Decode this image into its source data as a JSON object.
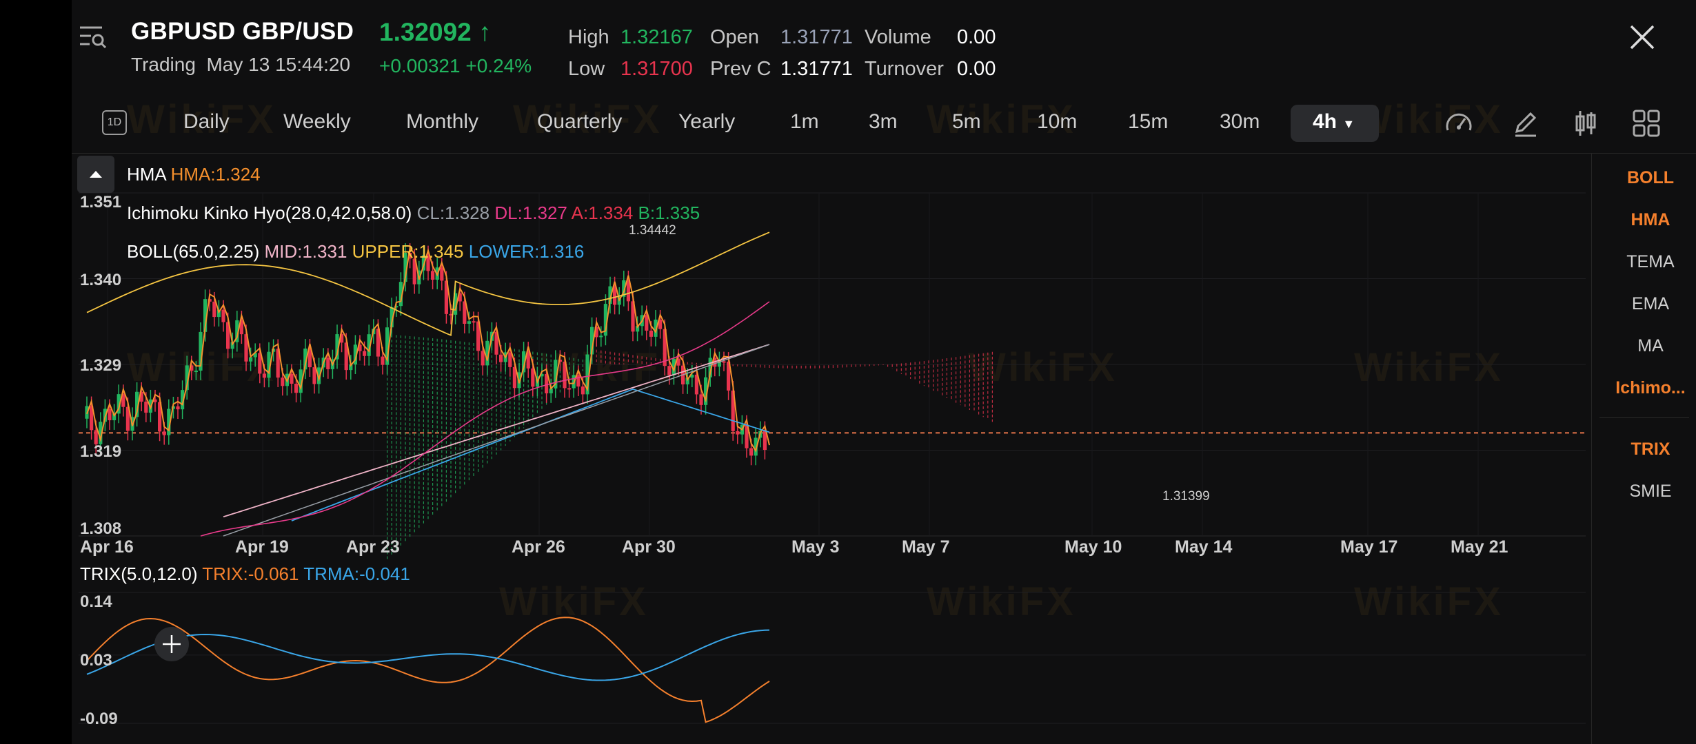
{
  "header": {
    "symbol": "GBPUSD",
    "pair": "GBP/USD",
    "price": "1.32092",
    "price_arrow": "↑",
    "status": "Trading",
    "datetime": "May 13 15:44:20",
    "change": "+0.00321",
    "change_pct": "+0.24%"
  },
  "stats": {
    "high_label": "High",
    "high": "1.32167",
    "low_label": "Low",
    "low": "1.31700",
    "open_label": "Open",
    "open": "1.31771",
    "prevc_label": "Prev C",
    "prevc": "1.31771",
    "volume_label": "Volume",
    "volume": "0.00",
    "turnover_label": "Turnover",
    "turnover": "0.00"
  },
  "timeframes": [
    "Daily",
    "Weekly",
    "Monthly",
    "Quarterly",
    "Yearly",
    "1m",
    "3m",
    "5m",
    "10m",
    "15m",
    "30m"
  ],
  "timeframe_icon_label": "1D",
  "active_timeframe": "4h",
  "toolbar": {
    "icons": [
      "speedometer-icon",
      "pen-icon",
      "candlestick-icon",
      "grid-icon"
    ]
  },
  "legend": {
    "hma": {
      "name": "HMA",
      "value": "HMA:1.324"
    },
    "ichimoku": {
      "name": "Ichimoku Kinko Hyo(28.0,42.0,58.0)",
      "cl": "CL:1.328",
      "dl": "DL:1.327",
      "a": "A:1.334",
      "b": "B:1.335"
    },
    "boll": {
      "name": "BOLL(65.0,2.25)",
      "mid": "MID:1.331",
      "upper": "UPPER:1.345",
      "lower": "LOWER:1.316"
    },
    "trix": {
      "name": "TRIX(5.0,12.0)",
      "trix": "TRIX:-0.061",
      "trma": "TRMA:-0.041"
    }
  },
  "side_indicators": [
    {
      "label": "BOLL",
      "active": true
    },
    {
      "label": "HMA",
      "active": true
    },
    {
      "label": "TEMA",
      "active": false
    },
    {
      "label": "EMA",
      "active": false
    },
    {
      "label": "MA",
      "active": false
    },
    {
      "label": "Ichimo...",
      "active": true
    },
    {
      "label": "TRIX",
      "active": true
    },
    {
      "label": "SMIE",
      "active": false
    }
  ],
  "price_axis": [
    "1.351",
    "1.340",
    "1.329",
    "1.319",
    "1.308"
  ],
  "trix_axis": [
    "0.14",
    "0.03",
    "-0.09"
  ],
  "date_axis": [
    "Apr 16",
    "Apr 19",
    "Apr 23",
    "Apr 26",
    "Apr 30",
    "May 3",
    "May 7",
    "May 10",
    "May 14",
    "May 17",
    "May 21"
  ],
  "annotations": {
    "max": "1.34442",
    "min": "1.31399"
  },
  "watermark": "WikiFX",
  "colors": {
    "up": "#22b55f",
    "down": "#e8344e",
    "accent": "#f5802d",
    "hma": "#f5902d",
    "boll_upper": "#f5c542",
    "boll_mid": "#f0b4c8",
    "boll_lower": "#3aa6e8",
    "ichimoku_cl": "#9aa0a8",
    "ichimoku_dl": "#e83a8a",
    "ichimoku_a": "#e8344e",
    "ichimoku_b": "#22b55f",
    "trix": "#f5802d",
    "trma": "#3aa6e8"
  }
}
